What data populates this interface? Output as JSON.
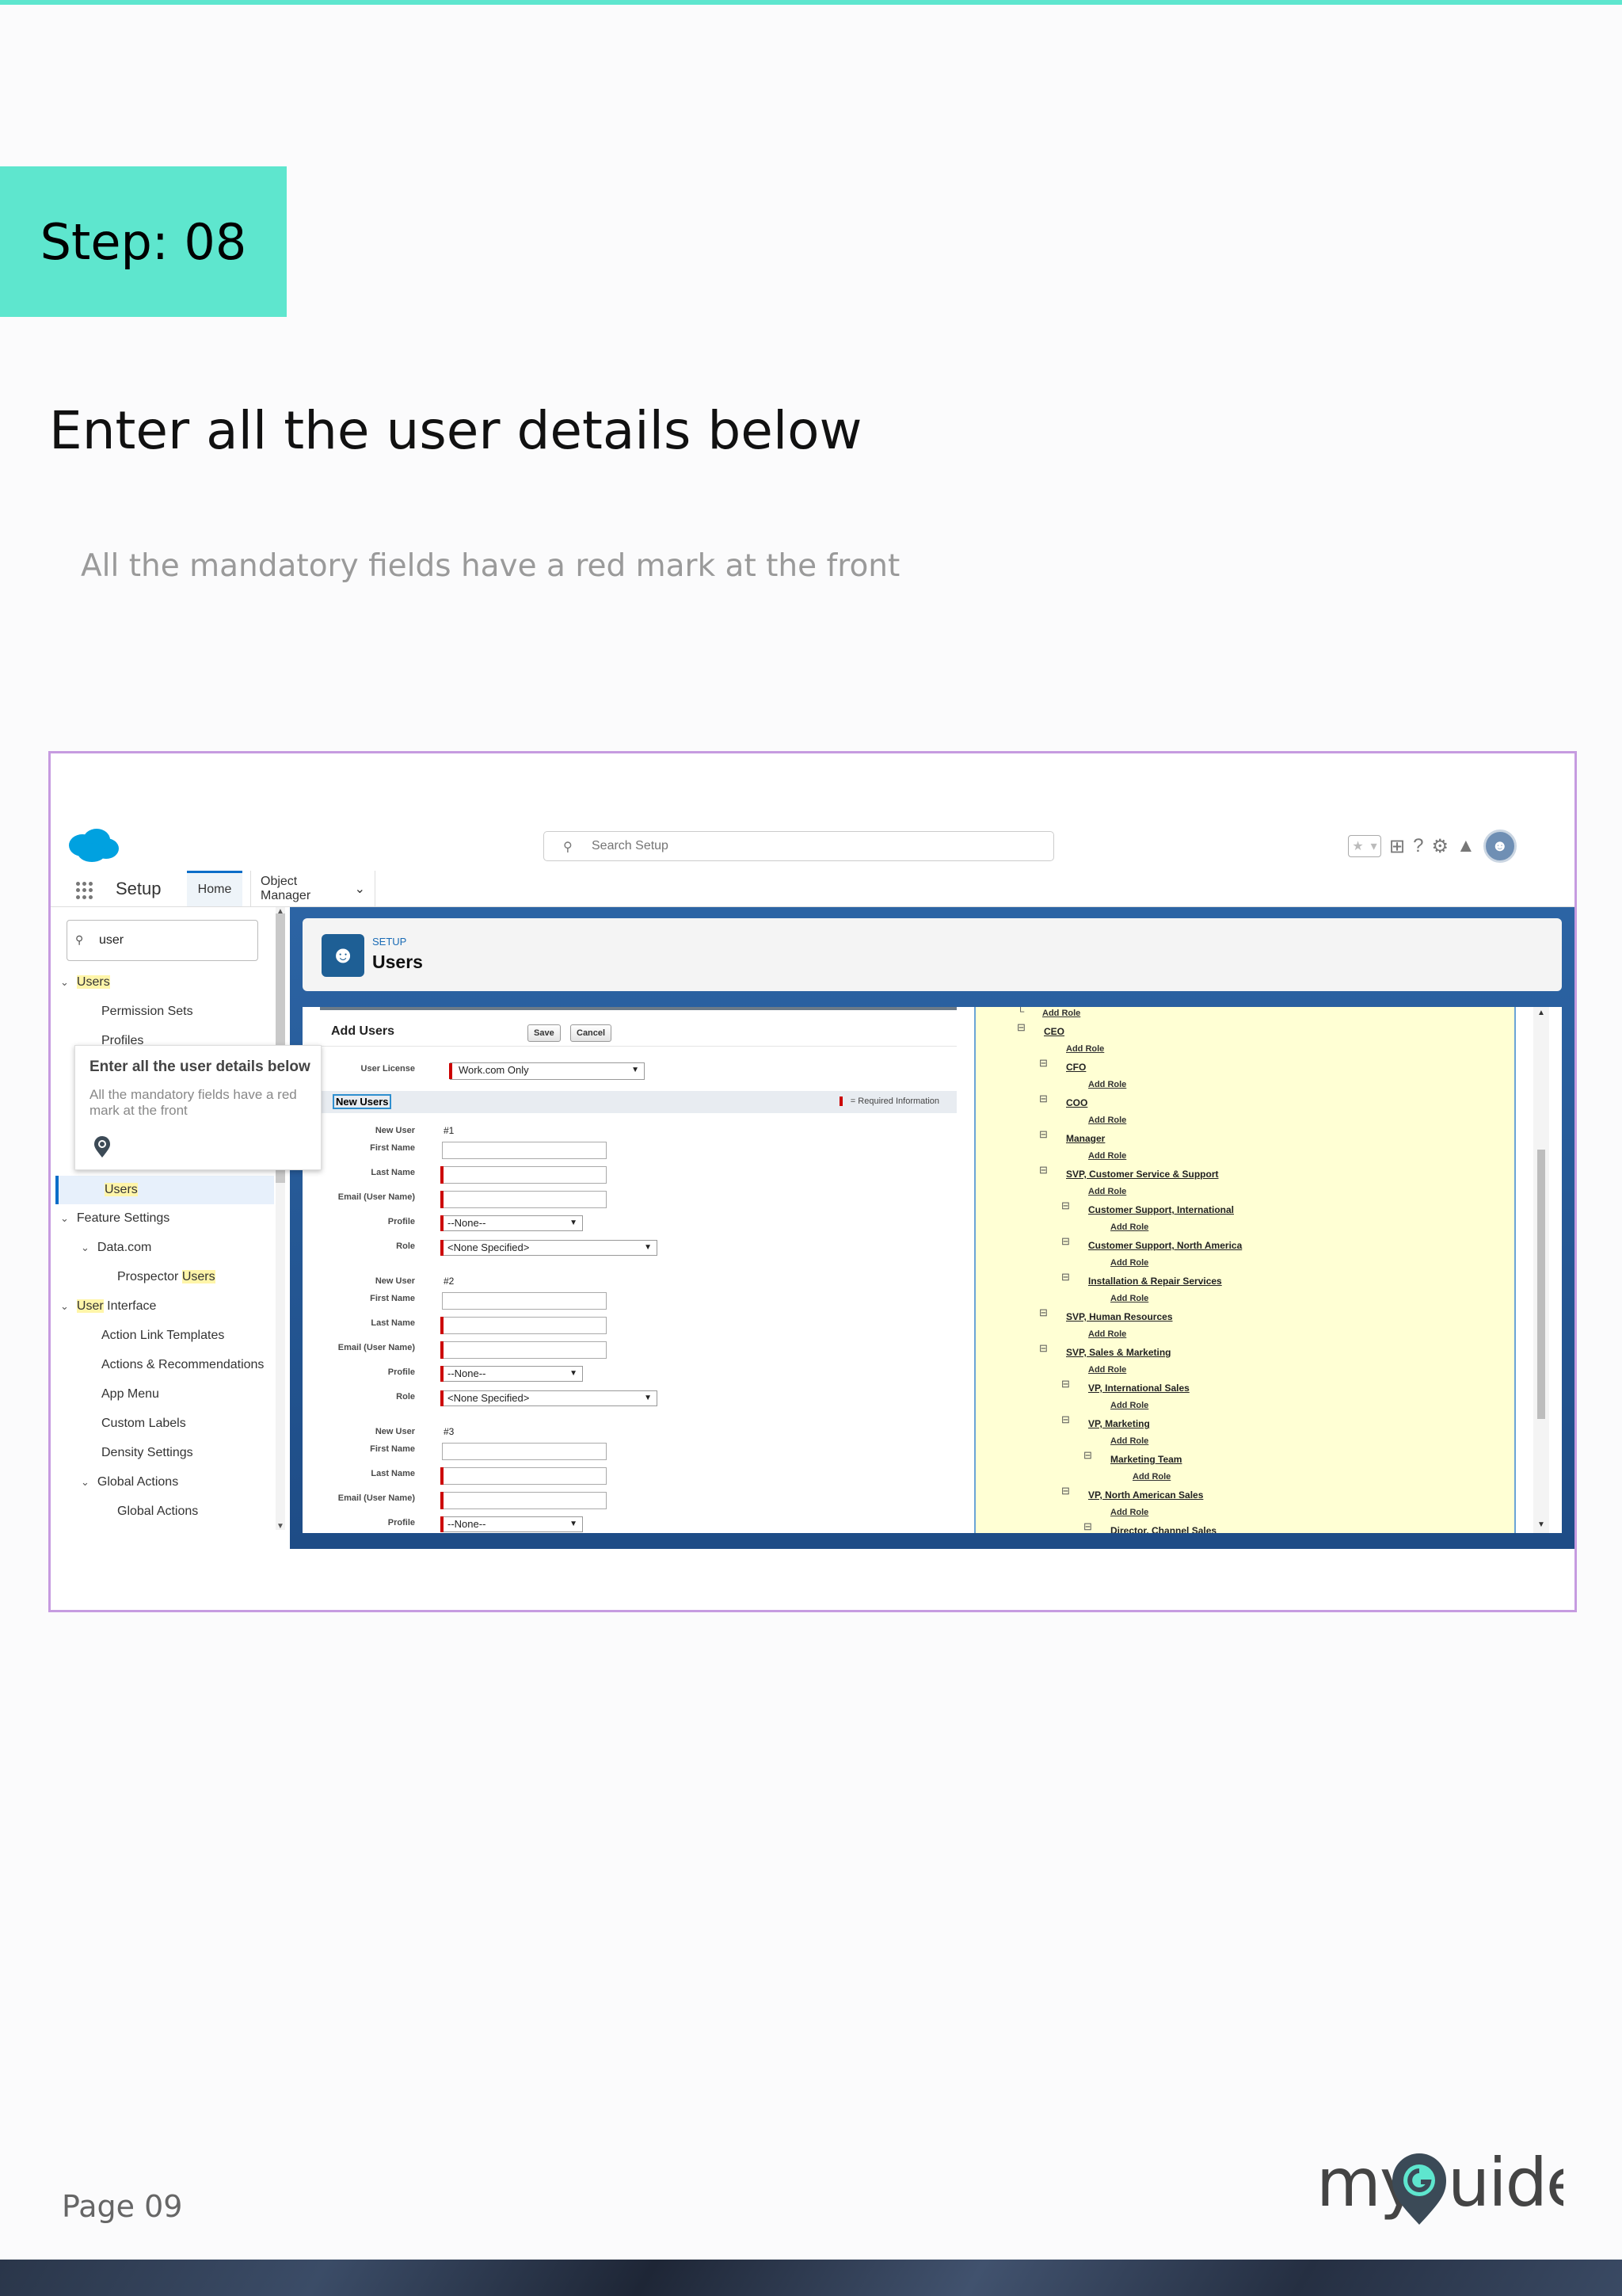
{
  "step": {
    "label": "Step: 08"
  },
  "title": "Enter all the user details below",
  "subtitle": "All the mandatory fields have a red mark at the front",
  "screenshot": {
    "header": {
      "search_placeholder": "Search Setup"
    },
    "nav": {
      "app_name": "Setup",
      "tabs": [
        "Home",
        "Object Manager"
      ]
    },
    "quick_find": {
      "value": "user"
    },
    "sidebar": {
      "items": [
        {
          "pre": "",
          "hl": "Users",
          "post": ""
        },
        {
          "pre": "Permission Sets",
          "hl": "",
          "post": ""
        },
        {
          "pre": "Profiles",
          "hl": "",
          "post": ""
        },
        {
          "pre": "",
          "hl": "Users",
          "post": ""
        },
        {
          "pre": "Feature Settings",
          "hl": "",
          "post": ""
        },
        {
          "pre": "Data.com",
          "hl": "",
          "post": ""
        },
        {
          "pre": "Prospector ",
          "hl": "Users",
          "post": ""
        },
        {
          "pre": "",
          "hl": "User",
          "post": " Interface"
        },
        {
          "pre": "Action Link Templates",
          "hl": "",
          "post": ""
        },
        {
          "pre": "Actions & Recommendations",
          "hl": "",
          "post": ""
        },
        {
          "pre": "App Menu",
          "hl": "",
          "post": ""
        },
        {
          "pre": "Custom Labels",
          "hl": "",
          "post": ""
        },
        {
          "pre": "Density Settings",
          "hl": "",
          "post": ""
        },
        {
          "pre": "Global Actions",
          "hl": "",
          "post": ""
        },
        {
          "pre": "Global Actions",
          "hl": "",
          "post": ""
        }
      ]
    },
    "hero": {
      "eyebrow": "SETUP",
      "title": "Users"
    },
    "form": {
      "title": "Add Users",
      "save": "Save",
      "cancel": "Cancel",
      "user_license_label": "User License",
      "user_license_value": "Work.com Only",
      "new_users": "New Users",
      "required_info": "= Required Information",
      "labels": {
        "new_user": "New User",
        "first_name": "First Name",
        "last_name": "Last Name",
        "email": "Email (User Name)",
        "profile": "Profile",
        "role": "Role"
      },
      "users": [
        {
          "num": "#1",
          "profile": "--None--",
          "role": "<None Specified>"
        },
        {
          "num": "#2",
          "profile": "--None--",
          "role": "<None Specified>"
        },
        {
          "num": "#3",
          "profile": "--None--"
        }
      ]
    },
    "roles": {
      "add_role": "Add Role",
      "names": [
        "CEO",
        "CFO",
        "COO",
        "Manager",
        "SVP, Customer Service & Support",
        "Customer Support, International",
        "Customer Support, North America",
        "Installation & Repair Services",
        "SVP, Human Resources",
        "SVP, Sales & Marketing",
        "VP, International Sales",
        "VP, Marketing",
        "Marketing Team",
        "VP, North American Sales",
        "Director, Channel Sales"
      ]
    },
    "tooltip": {
      "title": "Enter all the user details below",
      "body": "All the mandatory fields have a red mark at the front"
    }
  },
  "footer": {
    "page": "Page 09"
  },
  "logo": {
    "text": "myGuide"
  }
}
